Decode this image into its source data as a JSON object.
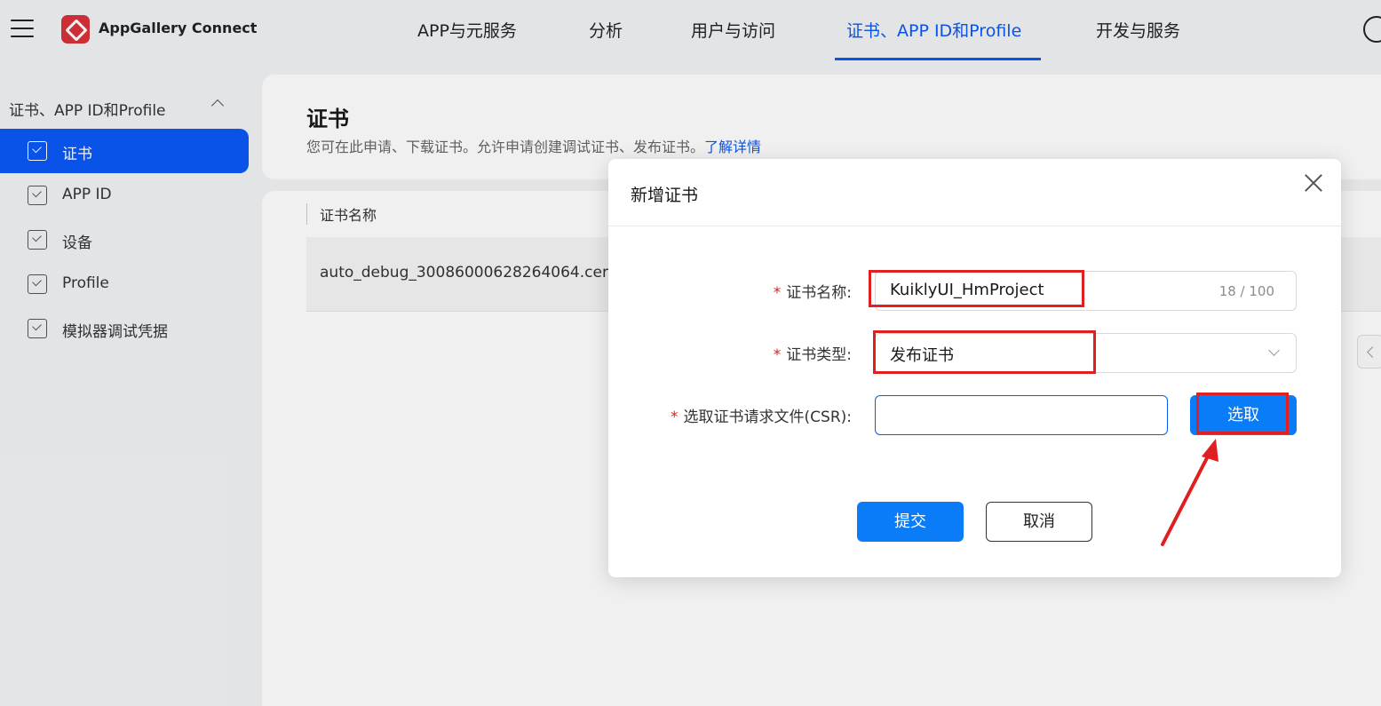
{
  "header": {
    "brand": "AppGallery Connect",
    "nav": [
      {
        "label": "APP与元服务"
      },
      {
        "label": "分析"
      },
      {
        "label": "用户与访问"
      },
      {
        "label": "证书、APP ID和Profile"
      },
      {
        "label": "开发与服务"
      }
    ],
    "active_tab": "证书、APP ID和Profile"
  },
  "sidebar": {
    "group_label": "证书、APP ID和Profile",
    "items": [
      {
        "label": "证书"
      },
      {
        "label": "APP ID"
      },
      {
        "label": "设备"
      },
      {
        "label": "Profile"
      },
      {
        "label": "模拟器调试凭据"
      }
    ],
    "active_item": "证书"
  },
  "main": {
    "title": "证书",
    "description": "您可在此申请、下载证书。允许申请创建调试证书、发布证书。",
    "learn_more": "了解详情",
    "table": {
      "column_header": "证书名称",
      "rows": [
        {
          "name": "auto_debug_30086000628264064.cer"
        }
      ]
    }
  },
  "dialog": {
    "title": "新增证书",
    "required_mark": "*",
    "cert_name": {
      "label": "证书名称:",
      "value": "KuiklyUI_HmProject",
      "counter": "18 / 100"
    },
    "cert_type": {
      "label": "证书类型:",
      "value": "发布证书"
    },
    "csr": {
      "label": "选取证书请求文件(CSR):",
      "value": "",
      "choose_label": "选取"
    },
    "submit_label": "提交",
    "cancel_label": "取消"
  },
  "colors": {
    "accent": "#0a59f7",
    "primary_button": "#0a7cf7",
    "annotation": "#e02020",
    "brand_logo": "#d9313a"
  },
  "icons": {
    "menu": "hamburger-icon",
    "logo": "appgallery-logo-icon",
    "sidebar_item": "folder-check-icon",
    "close": "close-icon",
    "select": "chevron-down-icon"
  }
}
